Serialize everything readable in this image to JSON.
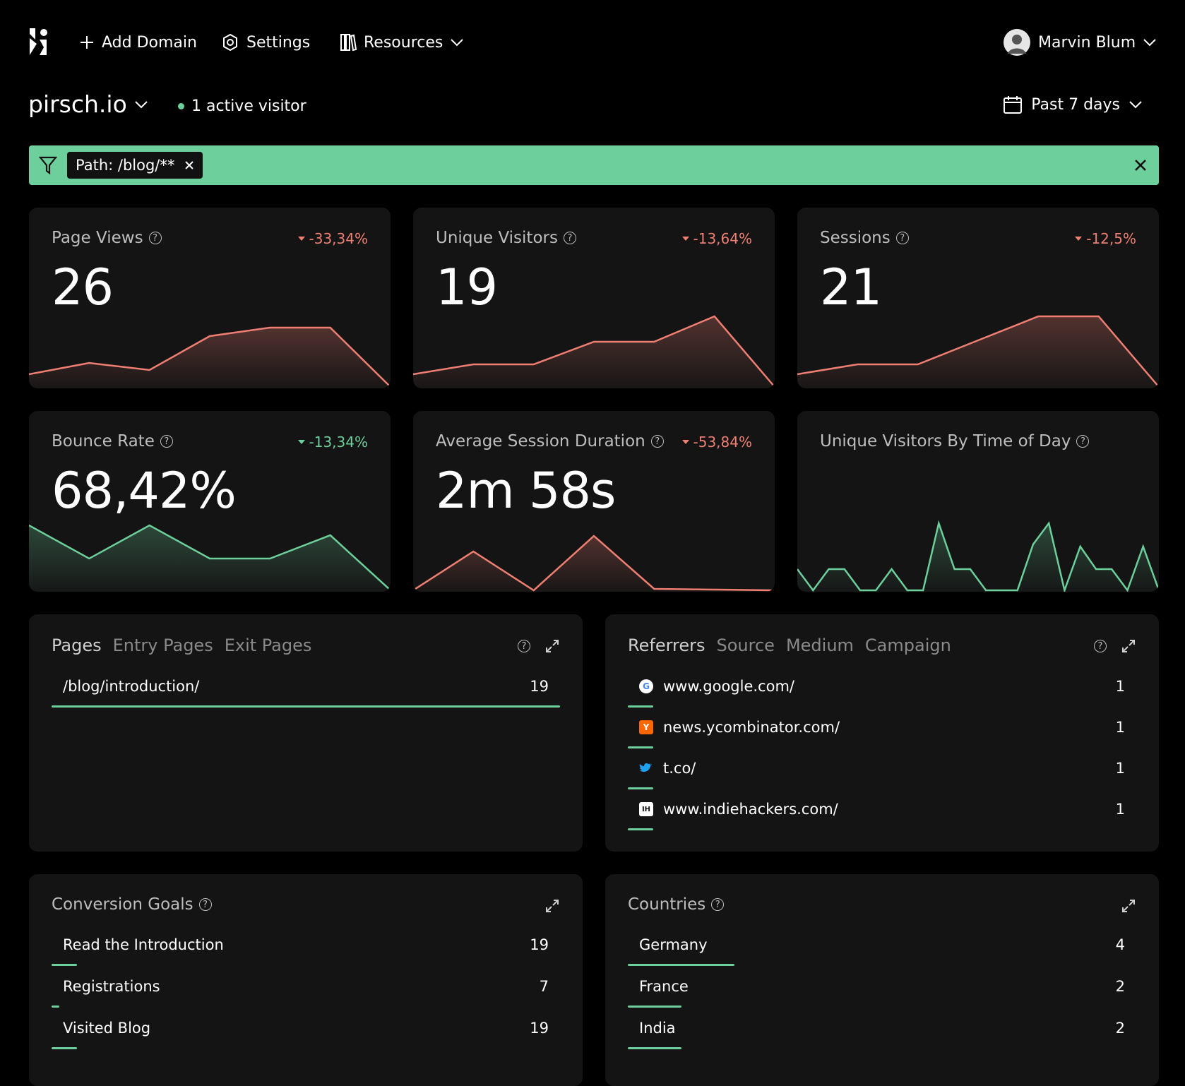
{
  "nav": {
    "add_domain": "Add Domain",
    "settings": "Settings",
    "resources": "Resources",
    "user": "Marvin Blum"
  },
  "header": {
    "site": "pirsch.io",
    "active_visitors": "1 active visitor",
    "period": "Past 7 days"
  },
  "filter": {
    "chip": "Path: /blog/**"
  },
  "colors": {
    "accent": "#6dcf9c",
    "negative": "#ef7f73",
    "card_bg": "#141414",
    "page_bg": "#000000"
  },
  "stats": {
    "page_views": {
      "title": "Page Views",
      "value": "26",
      "trend": "-33,34%",
      "series": [
        0.18,
        0.34,
        0.24,
        0.72,
        0.84,
        0.84,
        0.0
      ]
    },
    "unique_visitors": {
      "title": "Unique Visitors",
      "value": "19",
      "trend": "-13,64%",
      "series": [
        0.18,
        0.32,
        0.32,
        0.64,
        0.64,
        1.0,
        0.0
      ]
    },
    "sessions": {
      "title": "Sessions",
      "value": "21",
      "trend": "-12,5%",
      "series": [
        0.18,
        0.32,
        0.32,
        0.66,
        1.0,
        1.0,
        0.0
      ]
    },
    "bounce_rate": {
      "title": "Bounce Rate",
      "value": "68,42%",
      "trend": "-13,34%",
      "series": [
        0.92,
        0.45,
        0.92,
        0.45,
        0.45,
        0.78,
        0.0
      ]
    },
    "avg_session": {
      "title": "Average Session Duration",
      "value": "2m 58s",
      "trend": "-53,84%",
      "series": [
        0.0,
        0.55,
        0.0,
        0.77,
        0.02,
        0.01,
        0.0
      ]
    },
    "time_of_day": {
      "title": "Unique Visitors By Time of Day",
      "series": [
        0.3,
        0.0,
        0.3,
        0.3,
        0.0,
        0.0,
        0.3,
        0.0,
        0.0,
        0.95,
        0.3,
        0.3,
        0.0,
        0.0,
        0.0,
        0.65,
        0.95,
        0.0,
        0.62,
        0.3,
        0.3,
        0.0,
        0.62,
        0.0
      ]
    }
  },
  "pages": {
    "tabs": [
      "Pages",
      "Entry Pages",
      "Exit Pages"
    ],
    "rows": [
      {
        "label": "/blog/introduction/",
        "value": "19",
        "share": 1.0
      }
    ]
  },
  "referrers": {
    "tabs": [
      "Referrers",
      "Source",
      "Medium",
      "Campaign"
    ],
    "rows": [
      {
        "label": "www.google.com/",
        "value": "1",
        "icon": "google-icon",
        "share": 0.05
      },
      {
        "label": "news.ycombinator.com/",
        "value": "1",
        "icon": "ycombinator-icon",
        "share": 0.05
      },
      {
        "label": "t.co/",
        "value": "1",
        "icon": "twitter-icon",
        "share": 0.05
      },
      {
        "label": "www.indiehackers.com/",
        "value": "1",
        "icon": "indiehackers-icon",
        "share": 0.05
      }
    ]
  },
  "goals": {
    "title": "Conversion Goals",
    "rows": [
      {
        "label": "Read the Introduction",
        "value": "19",
        "share": 0.05
      },
      {
        "label": "Registrations",
        "value": "7",
        "share": 0.015
      },
      {
        "label": "Visited Blog",
        "value": "19",
        "share": 0.05
      }
    ]
  },
  "countries": {
    "title": "Countries",
    "rows": [
      {
        "label": "Germany",
        "value": "4",
        "share": 0.21
      },
      {
        "label": "France",
        "value": "2",
        "share": 0.105
      },
      {
        "label": "India",
        "value": "2",
        "share": 0.105
      }
    ]
  }
}
